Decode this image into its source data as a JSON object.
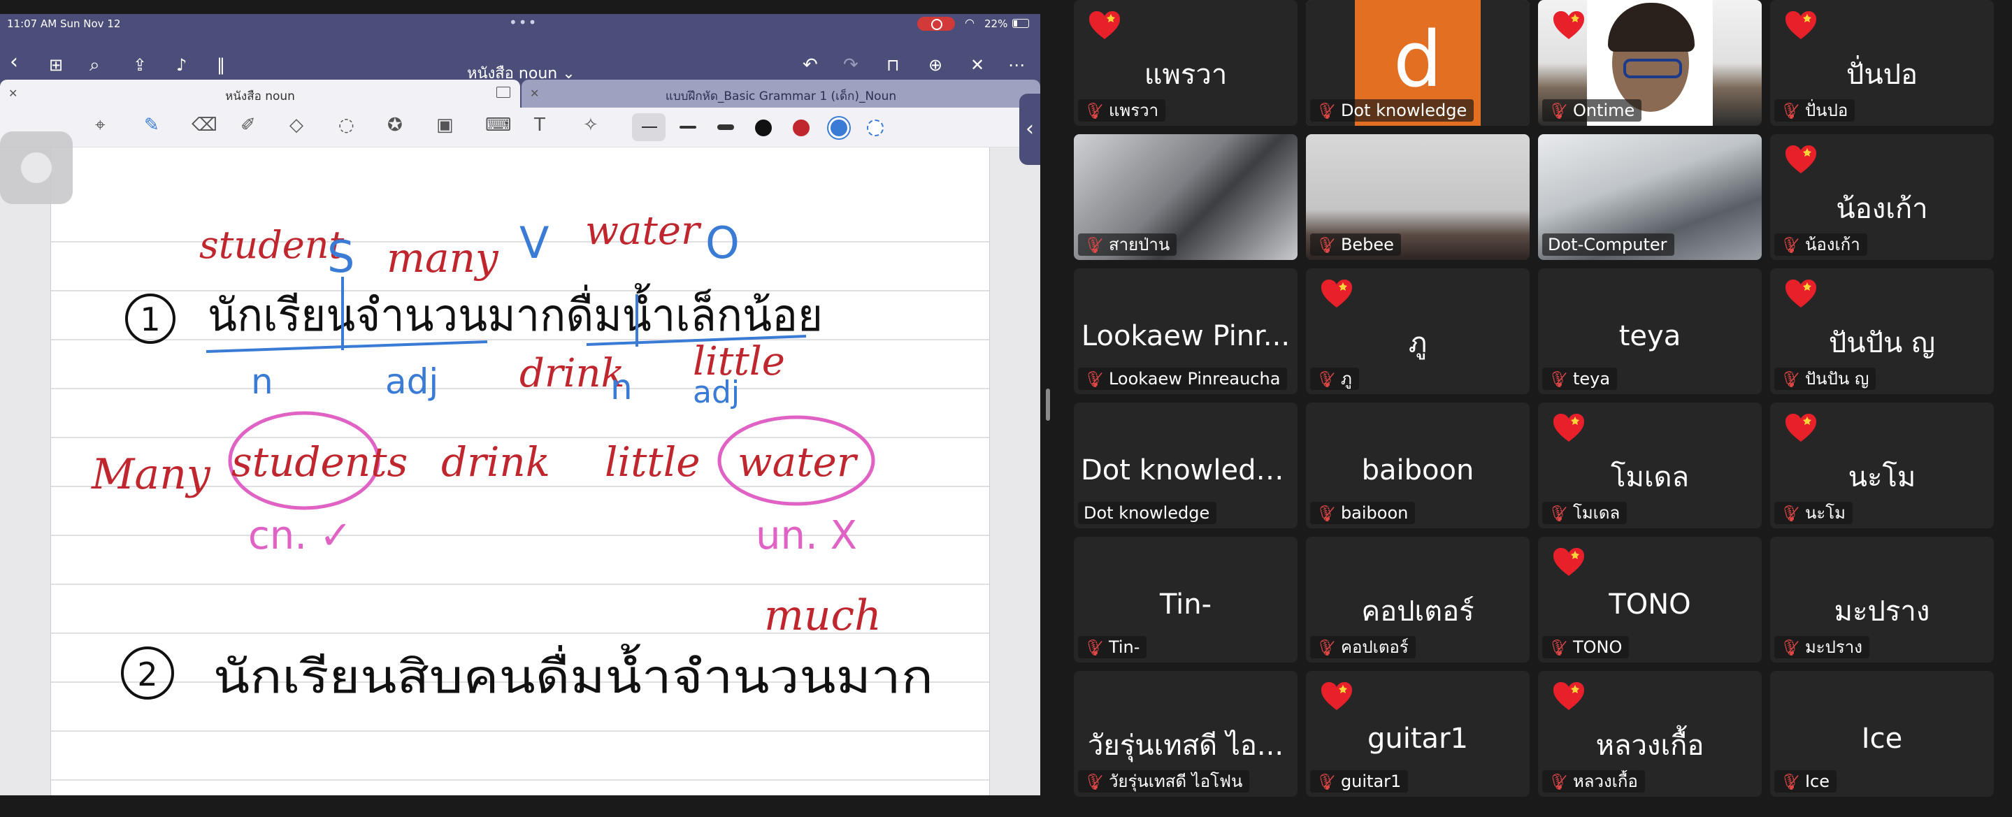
{
  "status_bar": {
    "time": "11:07 AM  Sun Nov 12",
    "battery": "22%"
  },
  "navbar": {
    "doc_title": "หนังสือ noun ⌄"
  },
  "tabs": [
    {
      "label": "หนังสือ noun",
      "active": true
    },
    {
      "label": "แบบฝึกหัด_Basic Grammar 1 (เด็ก)_Noun",
      "active": false
    }
  ],
  "note": {
    "line1": {
      "number": "1",
      "english_top": [
        "student",
        "S",
        "many",
        "V",
        "water",
        "O"
      ],
      "thai": "นักเรียนจำนวนมากดื่มน้ำเล็กน้อย",
      "annotations": [
        "n",
        "adj",
        "drink",
        "n",
        "little",
        "adj"
      ]
    },
    "line2": {
      "words": [
        "Many",
        "students",
        "drink",
        "little",
        "water"
      ],
      "marks": [
        "cn. ✓",
        "un. X"
      ]
    },
    "line3": {
      "number": "2",
      "thai": "นักเรียนสิบคนดื่มน้ำจำนวนมาก",
      "annotation": "much"
    }
  },
  "participants": [
    {
      "bigname": "แพรวา",
      "label": "แพรวา",
      "muted": true,
      "heart": true,
      "video": false
    },
    {
      "bigname": "",
      "label": "Dot knowledge",
      "muted": true,
      "heart": false,
      "video": "avatar-d",
      "speaking": true
    },
    {
      "bigname": "",
      "label": "Ontime",
      "muted": true,
      "heart": true,
      "video": "camera"
    },
    {
      "bigname": "ปั่นปอ",
      "label": "ปั่นปอ",
      "muted": true,
      "heart": true,
      "video": false
    },
    {
      "bigname": "",
      "label": "สายป่าน",
      "muted": true,
      "heart": false,
      "video": "camera"
    },
    {
      "bigname": "",
      "label": "Bebee",
      "muted": true,
      "heart": false,
      "video": "camera"
    },
    {
      "bigname": "",
      "label": "Dot-Computer",
      "muted": false,
      "heart": false,
      "video": "camera"
    },
    {
      "bigname": "น้องเก้า",
      "label": "น้องเก้า",
      "muted": true,
      "heart": true,
      "video": false
    },
    {
      "bigname": "Lookaew Pinr...",
      "label": "Lookaew Pinreaucha",
      "muted": true,
      "heart": false,
      "video": false
    },
    {
      "bigname": "ภู",
      "label": "ภู",
      "muted": true,
      "heart": true,
      "video": false
    },
    {
      "bigname": "teya",
      "label": "teya",
      "muted": true,
      "heart": false,
      "video": false
    },
    {
      "bigname": "ปันปัน ญ",
      "label": "ปันปัน ญ",
      "muted": true,
      "heart": true,
      "video": false
    },
    {
      "bigname": "Dot knowledge",
      "label": "Dot knowledge",
      "muted": false,
      "heart": false,
      "video": false
    },
    {
      "bigname": "baiboon",
      "label": "baiboon",
      "muted": true,
      "heart": false,
      "video": false
    },
    {
      "bigname": "โมเดล",
      "label": "โมเดล",
      "muted": true,
      "heart": true,
      "video": false
    },
    {
      "bigname": "นะโม",
      "label": "นะโม",
      "muted": true,
      "heart": true,
      "video": false
    },
    {
      "bigname": "Tin-",
      "label": "Tin-",
      "muted": true,
      "heart": false,
      "video": false
    },
    {
      "bigname": "คอปเตอร์",
      "label": "คอปเตอร์",
      "muted": true,
      "heart": false,
      "video": false
    },
    {
      "bigname": "TONO",
      "label": "TONO",
      "muted": true,
      "heart": true,
      "video": false
    },
    {
      "bigname": "มะปราง",
      "label": "มะปราง",
      "muted": true,
      "heart": false,
      "video": false
    },
    {
      "bigname": "วัยรุ่นเทสดี ไอ...",
      "label": "วัยรุ่นเทสดี ไอโฟน",
      "muted": true,
      "heart": false,
      "video": false
    },
    {
      "bigname": "guitar1",
      "label": "guitar1",
      "muted": true,
      "heart": true,
      "video": false
    },
    {
      "bigname": "หลวงเกื้อ",
      "label": "หลวงเกื้อ",
      "muted": true,
      "heart": true,
      "video": false
    },
    {
      "bigname": "Ice",
      "label": "Ice",
      "muted": true,
      "heart": false,
      "video": false
    }
  ],
  "avatar_letter": "d",
  "colors": {
    "ink_red": "#c0262d",
    "ink_blue": "#3a7bd5",
    "ink_pink": "#e062c4",
    "ink_black": "#111111",
    "speaking_outline": "#7bd16e",
    "avatar_orange": "#e36f23"
  }
}
